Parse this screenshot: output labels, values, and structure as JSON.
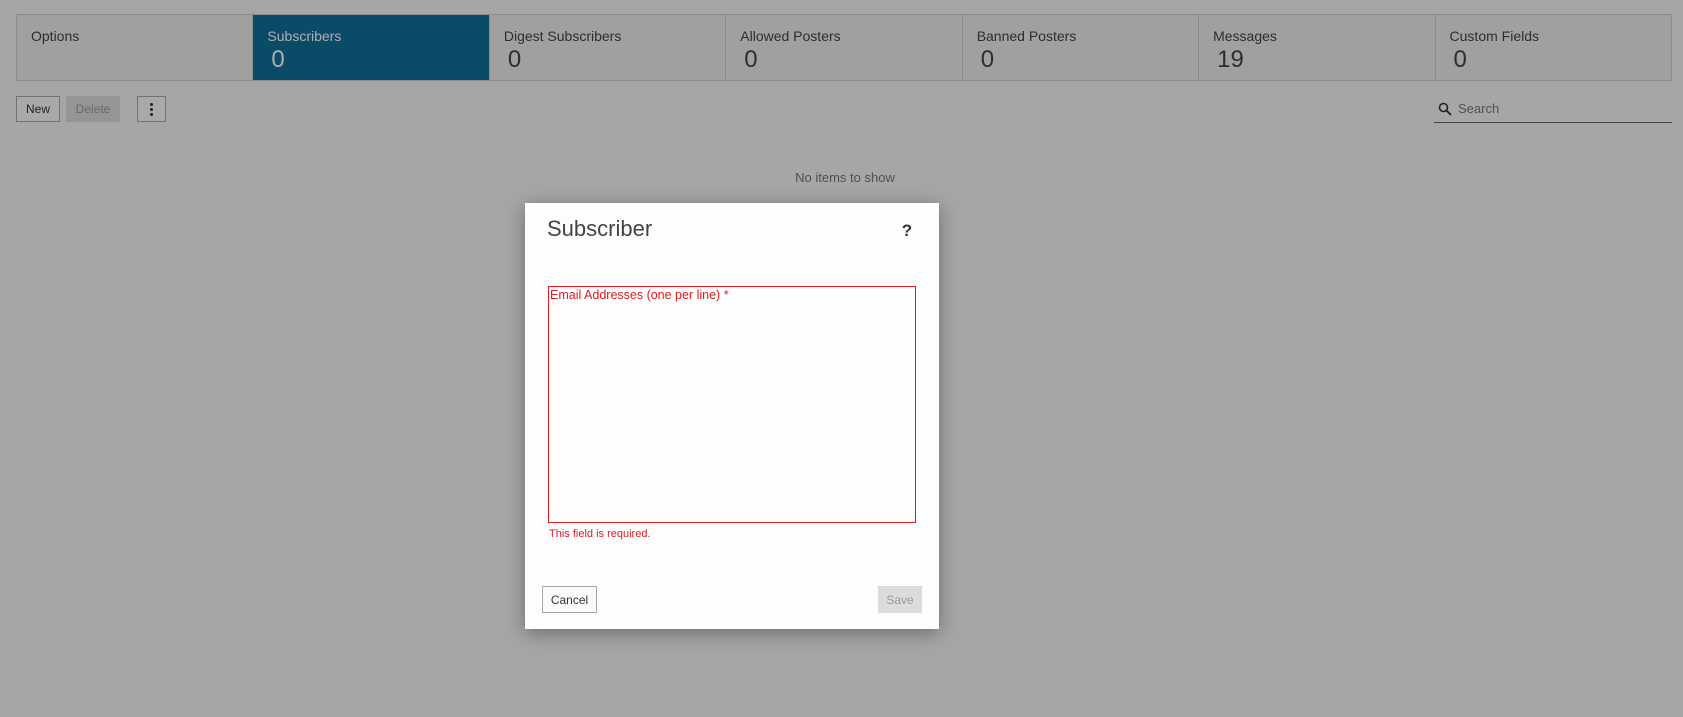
{
  "tabs": [
    {
      "label": "Options",
      "count": "",
      "active": false
    },
    {
      "label": "Subscribers",
      "count": "0",
      "active": true
    },
    {
      "label": "Digest Subscribers",
      "count": "0",
      "active": false
    },
    {
      "label": "Allowed Posters",
      "count": "0",
      "active": false
    },
    {
      "label": "Banned Posters",
      "count": "0",
      "active": false
    },
    {
      "label": "Messages",
      "count": "19",
      "active": false
    },
    {
      "label": "Custom Fields",
      "count": "0",
      "active": false
    }
  ],
  "toolbar": {
    "new_label": "New",
    "delete_label": "Delete",
    "more_icon": "more-vertical-icon"
  },
  "search": {
    "placeholder": "Search",
    "icon": "search-icon"
  },
  "list": {
    "empty_text": "No items to show"
  },
  "dialog": {
    "title": "Subscriber",
    "help_label": "?",
    "field_label": "Email Addresses (one per line) *",
    "field_value": "",
    "field_error": "This field is required.",
    "cancel_label": "Cancel",
    "save_label": "Save"
  },
  "colors": {
    "accent": "#0f6f9a",
    "error": "#e31b23"
  }
}
